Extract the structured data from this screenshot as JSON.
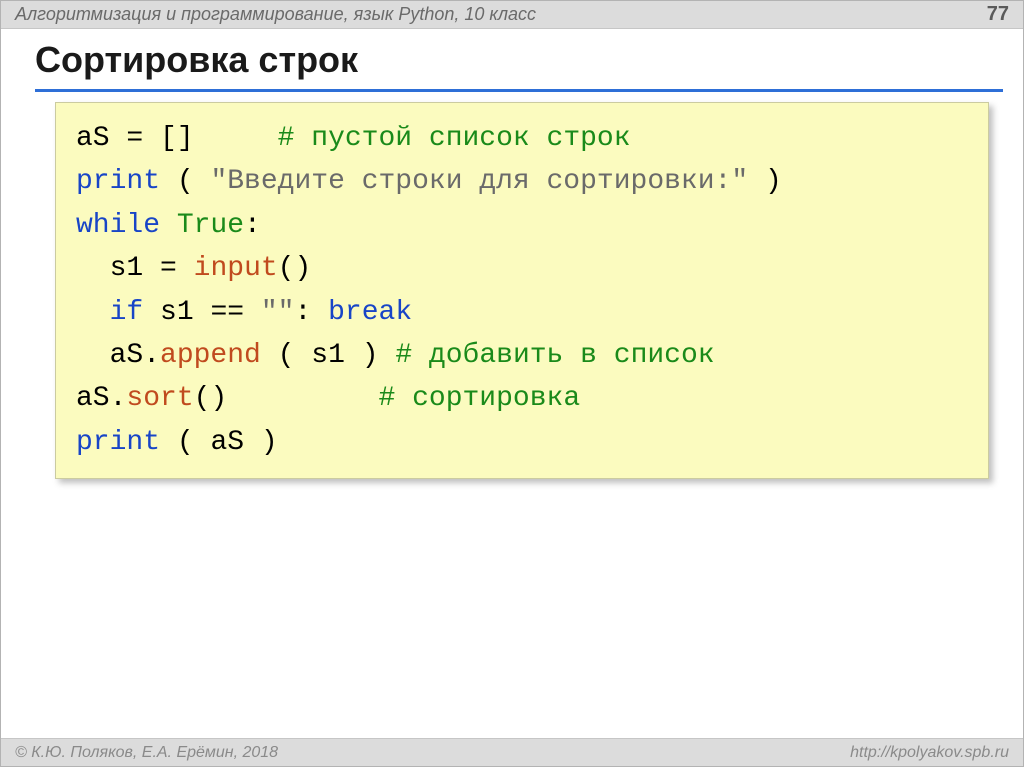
{
  "header": {
    "breadcrumb": "Алгоритмизация и программирование, язык Python, 10 класс",
    "page": "77"
  },
  "title": "Сортировка строк",
  "code": {
    "l1a": "aS",
    "l1b": "=",
    "l1c": "[]",
    "l1cmt": "# пустой список строк",
    "l2kw": "print",
    "l2s": "(",
    "l2str": "\"Введите строки для сортировки:\"",
    "l2e": ")",
    "l3kw": "while",
    "l3val": "True",
    "l3c": ":",
    "l4a": "  s1",
    "l4b": "=",
    "l4fn": "input",
    "l4p": "()",
    "l5kw": "if",
    "l5a": "s1",
    "l5b": "==",
    "l5str": "\"\"",
    "l5c": ":",
    "l5kw2": "break",
    "l6a": "  aS.",
    "l6fn": "append",
    "l6s": "(",
    "l6b": "s1",
    "l6e": ")",
    "l6cmt": "# добавить в список",
    "l7a": "aS.",
    "l7fn": "sort",
    "l7p": "()",
    "l7cmt": "# сортировка",
    "l8kw": "print",
    "l8s": "(",
    "l8a": "aS",
    "l8e": ")"
  },
  "footer": {
    "left": "© К.Ю. Поляков, Е.А. Ерёмин, 2018",
    "right": "http://kpolyakov.spb.ru"
  }
}
